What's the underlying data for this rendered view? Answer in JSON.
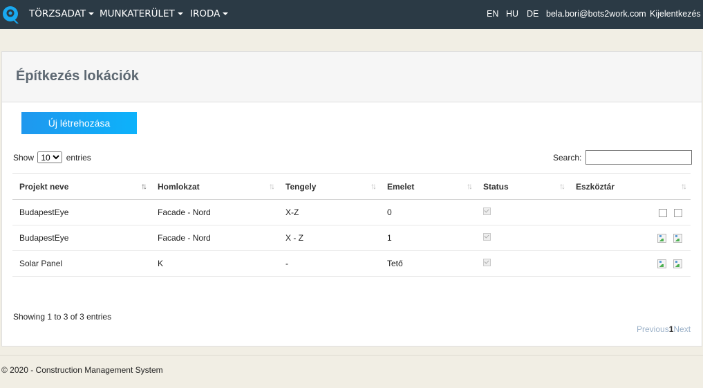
{
  "nav": {
    "menu": [
      "TÖRZSADAT",
      "MUNKATERÜLET",
      "IRODA"
    ],
    "languages": [
      "EN",
      "HU",
      "DE"
    ],
    "user_email": "bela.bori@bots2work.com",
    "logout": "Kijelentkezés"
  },
  "page": {
    "title": "Építkezés lokációk",
    "create_button": "Új létrehozása"
  },
  "table_controls": {
    "show_label": "Show",
    "entries_label": "entries",
    "page_size": "10",
    "page_size_options": [
      "10"
    ],
    "search_label": "Search:",
    "search_value": ""
  },
  "table": {
    "columns": [
      "Projekt neve",
      "Homlokzat",
      "Tengely",
      "Emelet",
      "Status",
      "Eszköztár"
    ],
    "rows": [
      {
        "project": "BudapestEye",
        "facade": "Facade - Nord",
        "axis": "X-Z",
        "floor": "0",
        "status": true
      },
      {
        "project": "BudapestEye",
        "facade": "Facade - Nord",
        "axis": "X - Z",
        "floor": "1",
        "status": true
      },
      {
        "project": "Solar Panel",
        "facade": "K",
        "axis": "-",
        "floor": "Tető",
        "status": true
      }
    ]
  },
  "pagination": {
    "info": "Showing 1 to 3 of 3 entries",
    "previous": "Previous",
    "current": "1",
    "next": "Next"
  },
  "footer": {
    "text": "© 2020 - Construction Management System"
  },
  "colors": {
    "navbar": "#2b3a45",
    "accent": "#0db2fb",
    "background": "#f1eee4"
  }
}
